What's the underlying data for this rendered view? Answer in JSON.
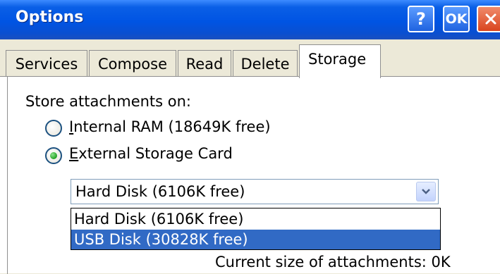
{
  "window": {
    "title": "Options",
    "help_label": "?",
    "ok_label": "OK"
  },
  "tabs": [
    {
      "label": "Services"
    },
    {
      "label": "Compose"
    },
    {
      "label": "Read"
    },
    {
      "label": "Delete"
    },
    {
      "label": "Storage",
      "active": true
    }
  ],
  "storage": {
    "heading": "Store attachments on:",
    "options": [
      {
        "label_first": "I",
        "label_rest": "nternal RAM (18649K free)",
        "selected": false
      },
      {
        "label_first": "E",
        "label_rest": "xternal Storage Card",
        "selected": true
      }
    ],
    "combo": {
      "value": "Hard Disk (6106K free)",
      "items": [
        {
          "label": "Hard Disk (6106K free)",
          "highlighted": false
        },
        {
          "label": "USB Disk (30828K free)",
          "highlighted": true
        }
      ]
    },
    "footer": "Current size of attachments: 0K"
  },
  "colors": {
    "titlebar": "#0054e3",
    "selection": "#316ac5",
    "radio_selected": "#21a121"
  }
}
